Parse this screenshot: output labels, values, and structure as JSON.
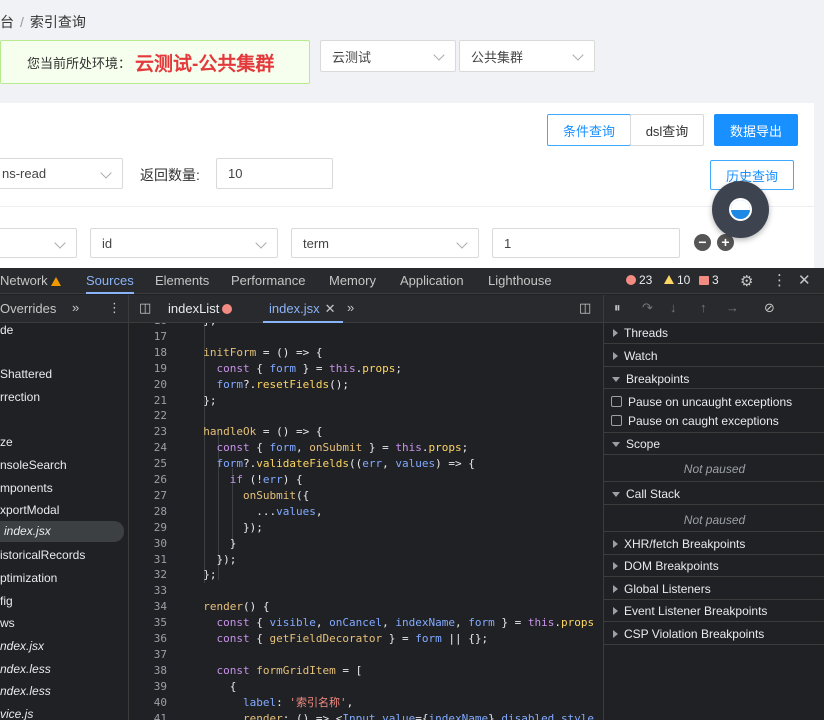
{
  "breadcrumb": {
    "parent": "台",
    "sep": "/",
    "current": "索引查询"
  },
  "env": {
    "label": "您当前所处环境：",
    "value": "云测试-公共集群"
  },
  "selects": {
    "env": "云测试",
    "cluster": "公共集群"
  },
  "query": {
    "btn_condition": "条件查询",
    "btn_dsl": "dsl查询",
    "btn_export": "数据导出",
    "index_select": "ns-read",
    "return_label": "返回数量:",
    "return_value": "10",
    "btn_history": "历史查询",
    "field_select": "id",
    "op_select": "term",
    "value_input": "1"
  },
  "devtools": {
    "tabs": [
      "Network",
      "Sources",
      "Elements",
      "Performance",
      "Memory",
      "Application",
      "Lighthouse"
    ],
    "counts": {
      "errors": "23",
      "warnings": "10",
      "issues": "3"
    },
    "nav_tab": "Overrides",
    "file_tabs": [
      "indexList",
      "index.jsx"
    ],
    "nav_items": [
      "de",
      "Shattered",
      "rrection",
      "ze",
      "nsoleSearch",
      "mponents",
      "xportModal",
      "index.jsx",
      "istoricalRecords",
      "ptimization",
      "fig",
      "ws",
      "ndex.jsx",
      "ndex.less",
      "ndex.less",
      "vice.js"
    ],
    "side": {
      "threads": "Threads",
      "watch": "Watch",
      "breakpoints": "Breakpoints",
      "pause_uncaught": "Pause on uncaught exceptions",
      "pause_caught": "Pause on caught exceptions",
      "scope": "Scope",
      "scope_status": "Not paused",
      "call_stack": "Call Stack",
      "call_status": "Not paused",
      "xhr": "XHR/fetch Breakpoints",
      "dom": "DOM Breakpoints",
      "global": "Global Listeners",
      "event": "Event Listener Breakpoints",
      "csp": "CSP Violation Breakpoints"
    },
    "code_lines": [
      {
        "n": "16",
        "t": "  };"
      },
      {
        "n": "17",
        "t": ""
      },
      {
        "n": "18",
        "t": "  initForm = () => {"
      },
      {
        "n": "19",
        "t": "    const { form } = this.props;"
      },
      {
        "n": "20",
        "t": "    form?.resetFields();"
      },
      {
        "n": "21",
        "t": "  };"
      },
      {
        "n": "22",
        "t": ""
      },
      {
        "n": "23",
        "t": "  handleOk = () => {"
      },
      {
        "n": "24",
        "t": "    const { form, onSubmit } = this.props;"
      },
      {
        "n": "25",
        "t": "    form?.validateFields((err, values) => {"
      },
      {
        "n": "26",
        "t": "      if (!err) {"
      },
      {
        "n": "27",
        "t": "        onSubmit({"
      },
      {
        "n": "28",
        "t": "          ...values,"
      },
      {
        "n": "29",
        "t": "        });"
      },
      {
        "n": "30",
        "t": "      }"
      },
      {
        "n": "31",
        "t": "    });"
      },
      {
        "n": "32",
        "t": "  };"
      },
      {
        "n": "33",
        "t": ""
      },
      {
        "n": "34",
        "t": "  render() {"
      },
      {
        "n": "35",
        "t": "    const { visible, onCancel, indexName, form } = this.props"
      },
      {
        "n": "36",
        "t": "    const { getFieldDecorator } = form || {};"
      },
      {
        "n": "37",
        "t": ""
      },
      {
        "n": "38",
        "t": "    const formGridItem = ["
      },
      {
        "n": "39",
        "t": "      {"
      },
      {
        "n": "40",
        "t": "        label: '索引名称',"
      },
      {
        "n": "41",
        "t": "        render: () => <Input value={indexName} disabled style"
      }
    ]
  }
}
